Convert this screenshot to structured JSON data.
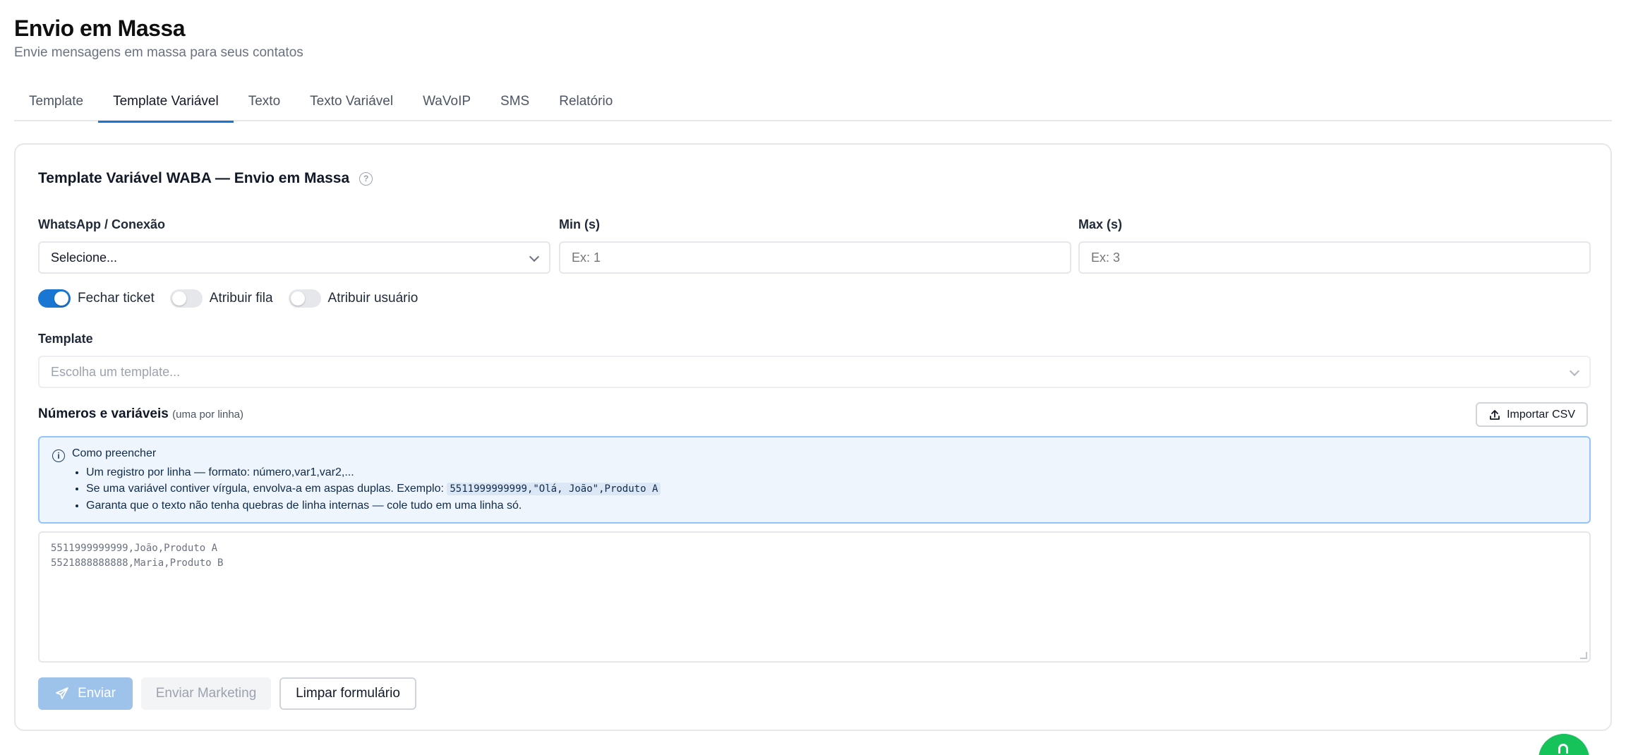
{
  "header": {
    "title": "Envio em Massa",
    "subtitle": "Envie mensagens em massa para seus contatos"
  },
  "tabs": [
    {
      "label": "Template",
      "active": false
    },
    {
      "label": "Template Variável",
      "active": true
    },
    {
      "label": "Texto",
      "active": false
    },
    {
      "label": "Texto Variável",
      "active": false
    },
    {
      "label": "WaVoIP",
      "active": false
    },
    {
      "label": "SMS",
      "active": false
    },
    {
      "label": "Relatório",
      "active": false
    }
  ],
  "card": {
    "title": "Template Variável WABA — Envio em Massa",
    "help_icon": "question-circle-icon"
  },
  "connection": {
    "label": "WhatsApp / Conexão",
    "value": "Selecione..."
  },
  "min": {
    "label": "Min (s)",
    "placeholder": "Ex: 1"
  },
  "max": {
    "label": "Max (s)",
    "placeholder": "Ex: 3"
  },
  "toggles": {
    "close_ticket": {
      "label": "Fechar ticket",
      "on": true
    },
    "assign_queue": {
      "label": "Atribuir fila",
      "on": false
    },
    "assign_user": {
      "label": "Atribuir usuário",
      "on": false
    }
  },
  "template": {
    "label": "Template",
    "placeholder": "Escolha um template..."
  },
  "numbers": {
    "label": "Números e variáveis",
    "hint": "(uma por linha)",
    "import_button": "Importar CSV"
  },
  "info": {
    "title": "Como preencher",
    "item1": "Um registro por linha — formato: número,var1,var2,...",
    "item2_text": "Se uma variável contiver vírgula, envolva-a em aspas duplas. Exemplo:",
    "item2_code": "5511999999999,\"Olá, João\",Produto A",
    "item3": "Garanta que o texto não tenha quebras de linha internas — cole tudo em uma linha só."
  },
  "textarea": {
    "placeholder_line1": "5511999999999,João,Produto A",
    "placeholder_line2": "5521888888888,Maria,Produto B"
  },
  "actions": {
    "send": "Enviar",
    "marketing": "Enviar Marketing",
    "clear": "Limpar formulário"
  },
  "colors": {
    "accent": "#1976d2",
    "send_disabled": "#9dc3ea",
    "info_bg": "#eef5fd",
    "info_border": "#93c5fd",
    "fab": "#16c25a"
  }
}
